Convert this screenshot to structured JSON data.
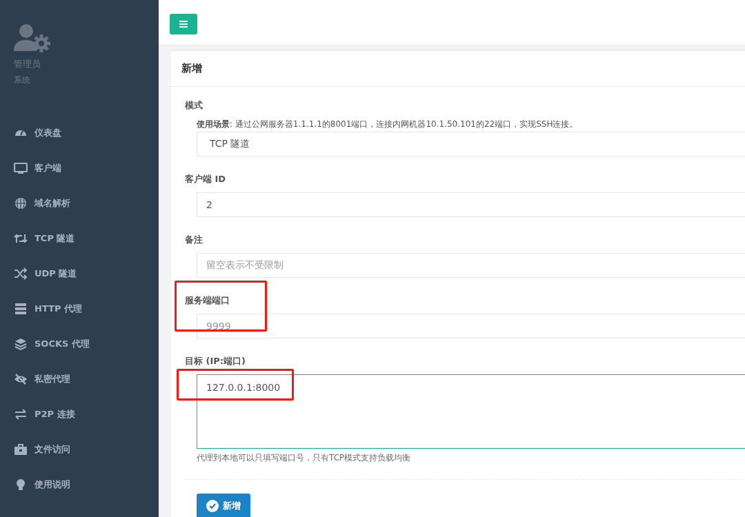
{
  "user": {
    "name": "管理员",
    "role": "系统"
  },
  "sidebar": {
    "items": [
      {
        "label": "仪表盘"
      },
      {
        "label": "客户端"
      },
      {
        "label": "域名解析"
      },
      {
        "label": "TCP 隧道"
      },
      {
        "label": "UDP 隧道"
      },
      {
        "label": "HTTP 代理"
      },
      {
        "label": "SOCKS 代理"
      },
      {
        "label": "私密代理"
      },
      {
        "label": "P2P 连接"
      },
      {
        "label": "文件访问"
      },
      {
        "label": "使用说明"
      }
    ]
  },
  "card": {
    "title": "新增",
    "fields": [
      {
        "kind": "select",
        "label": "模式",
        "hint": "**使用场景**: 通过公网服务器1.1.1.1的8001端口，连接内网机器10.1.50.101的22端口，实现SSH连接。",
        "value": "TCP 隧道",
        "highlighted": false,
        "focused": false
      },
      {
        "kind": "input",
        "label": "客户端 ID",
        "value": "2",
        "highlighted": false,
        "focused": false
      },
      {
        "kind": "input",
        "label": "备注",
        "placeholder": "留空表示不受限制",
        "highlighted": false,
        "focused": false
      },
      {
        "kind": "input",
        "label": "服务端端口",
        "placeholder": "9999",
        "highlighted": true,
        "focused": false
      },
      {
        "kind": "textarea",
        "label": "目标 (IP:端口)",
        "value": "127.0.0.1:8000",
        "help": "代理到本地可以只填写端口号，只有TCP模式支持负载均衡",
        "highlighted": true,
        "focused": true
      }
    ],
    "submit": "新增"
  }
}
